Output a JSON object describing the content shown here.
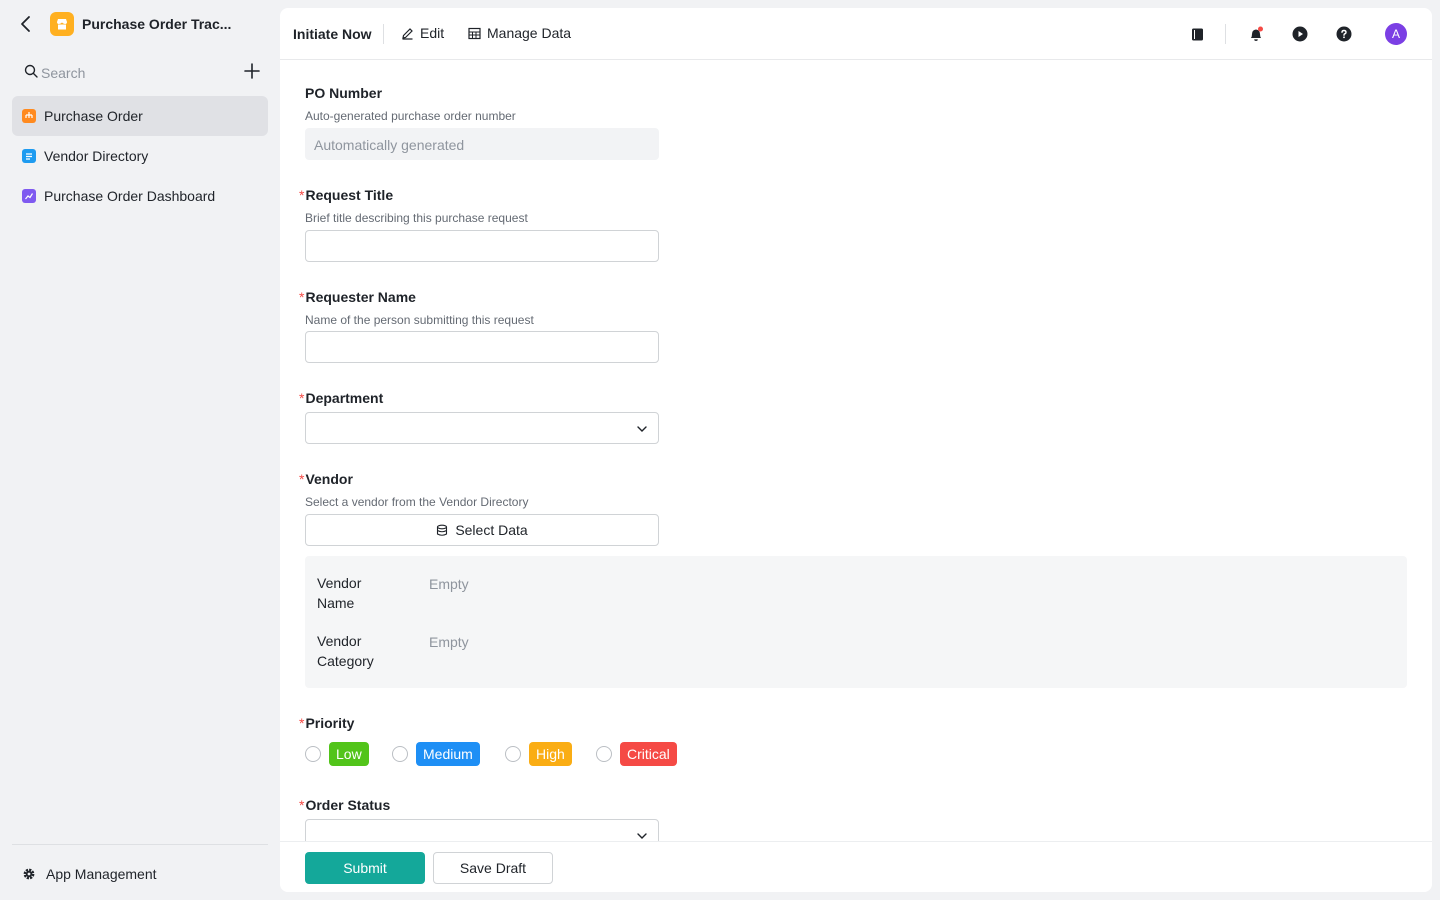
{
  "app": {
    "title": "Purchase Order Trac...",
    "logo_color": "#ffb020"
  },
  "sidebar": {
    "search_placeholder": "Search",
    "items": [
      {
        "label": "Purchase Order",
        "icon": "form-icon",
        "color": "#ff8a1f",
        "active": true
      },
      {
        "label": "Vendor Directory",
        "icon": "table-icon",
        "color": "#1e9bf0",
        "active": false
      },
      {
        "label": "Purchase Order Dashboard",
        "icon": "dashboard-icon",
        "color": "#7f5af0",
        "active": false
      }
    ],
    "footer_label": "App Management"
  },
  "toolbar": {
    "initiate_label": "Initiate Now",
    "edit_label": "Edit",
    "manage_data_label": "Manage Data",
    "icons": [
      "book-icon",
      "bell-icon",
      "play-icon",
      "help-icon"
    ],
    "avatar_initial": "A",
    "avatar_color": "#7b3fe4"
  },
  "form": {
    "po_number": {
      "label": "PO Number",
      "description": "Auto-generated purchase order number",
      "placeholder": "Automatically generated"
    },
    "request_title": {
      "label": "Request Title",
      "required": "*",
      "description": "Brief title describing this purchase request",
      "value": ""
    },
    "requester_name": {
      "label": "Requester Name",
      "required": "*",
      "description": "Name of the person submitting this request",
      "value": ""
    },
    "department": {
      "label": "Department",
      "required": "*",
      "value": ""
    },
    "vendor": {
      "label": "Vendor",
      "required": "*",
      "description": "Select a vendor from the Vendor Directory",
      "select_button": "Select Data",
      "fields": [
        {
          "key": "Vendor Name",
          "value": "Empty"
        },
        {
          "key": "Vendor Category",
          "value": "Empty"
        }
      ]
    },
    "priority": {
      "label": "Priority",
      "required": "*",
      "options": [
        {
          "label": "Low",
          "color": "#52c41a"
        },
        {
          "label": "Medium",
          "color": "#1e8ff5"
        },
        {
          "label": "High",
          "color": "#faad14"
        },
        {
          "label": "Critical",
          "color": "#f54a45"
        }
      ]
    },
    "order_status": {
      "label": "Order Status",
      "required": "*",
      "value": ""
    }
  },
  "footer": {
    "submit_label": "Submit",
    "draft_label": "Save Draft",
    "submit_color": "#14a89a"
  }
}
